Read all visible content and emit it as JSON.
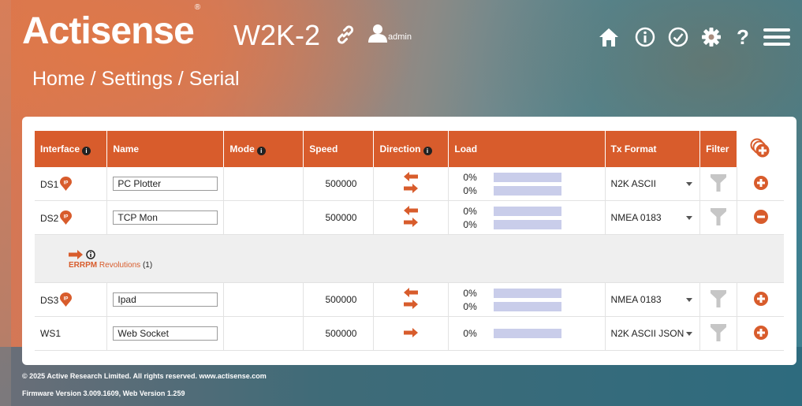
{
  "brand": {
    "name": "Actisense",
    "registered": "®"
  },
  "device": {
    "name": "W2K-2"
  },
  "user": {
    "name": "admin"
  },
  "breadcrumb": "Home / Settings / Serial",
  "nav_icons": [
    "home-icon",
    "info-icon",
    "check-circle-icon",
    "gear-icon",
    "help-icon",
    "menu-icon"
  ],
  "table": {
    "headers": {
      "interface": "Interface",
      "name": "Name",
      "mode": "Mode",
      "speed": "Speed",
      "direction": "Direction",
      "load": "Load",
      "tx_format": "Tx Format",
      "filter": "Filter"
    },
    "rows": [
      {
        "interface": "DS1",
        "badge": "IP",
        "name": "PC Plotter",
        "speed": "500000",
        "load_in": "0%",
        "load_out": "0%",
        "tx_format": "N2K ASCII",
        "action": "add"
      },
      {
        "interface": "DS2",
        "badge": "IP",
        "name": "TCP Mon",
        "speed": "500000",
        "load_in": "0%",
        "load_out": "0%",
        "tx_format": "NMEA 0183",
        "action": "remove"
      },
      {
        "interface": "DS3",
        "badge": "IP",
        "name": "Ipad",
        "speed": "500000",
        "load_in": "0%",
        "load_out": "0%",
        "tx_format": "NMEA 0183",
        "action": "add"
      },
      {
        "interface": "WS1",
        "name": "Web Socket",
        "speed": "500000",
        "load_out": "0%",
        "tx_format": "N2K ASCII JSON",
        "action": "add"
      }
    ],
    "sub_row": {
      "pgn": "ERRPM",
      "label": "Revolutions",
      "count": "(1)"
    }
  },
  "colors": {
    "accent": "#d85c2c",
    "load_bar": "#c9cdea"
  },
  "footer": {
    "copyright": "© 2025 Active Research Limited. All rights reserved.  www.actisense.com",
    "firmware": "Firmware Version 3.009.1609, Web Version 1.259"
  }
}
